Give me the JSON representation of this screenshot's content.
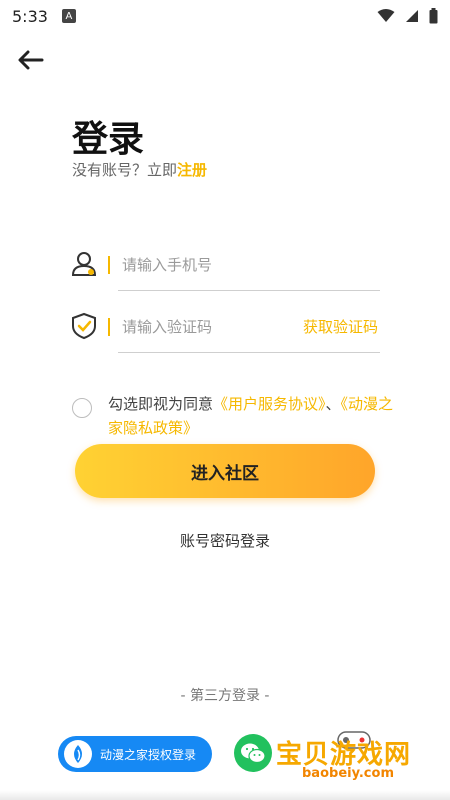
{
  "status_bar": {
    "time": "5:33",
    "badge": "A"
  },
  "header": {
    "title": "登录",
    "subtitle_prefix": "没有账号？立即",
    "register_link": "注册"
  },
  "form": {
    "phone_placeholder": "请输入手机号",
    "code_placeholder": "请输入验证码",
    "get_code_label": "获取验证码"
  },
  "agreement": {
    "prefix": "勾选即视为同意",
    "user_agreement": "《用户服务协议》",
    "separator": "、",
    "privacy_policy": "《动漫之家隐私政策》"
  },
  "buttons": {
    "enter": "进入社区",
    "password_login": "账号密码登录"
  },
  "third_party": {
    "title": "-  第三方登录  -",
    "auth_label": "动漫之家授权登录"
  },
  "watermark": {
    "title": "宝贝游戏网",
    "url": "baobeiy.com"
  },
  "colors": {
    "accent": "#F6B800",
    "button_start": "#FFD233",
    "button_end": "#FFA52A",
    "auth_blue": "#1689F4",
    "wechat_green": "#22C15E"
  }
}
